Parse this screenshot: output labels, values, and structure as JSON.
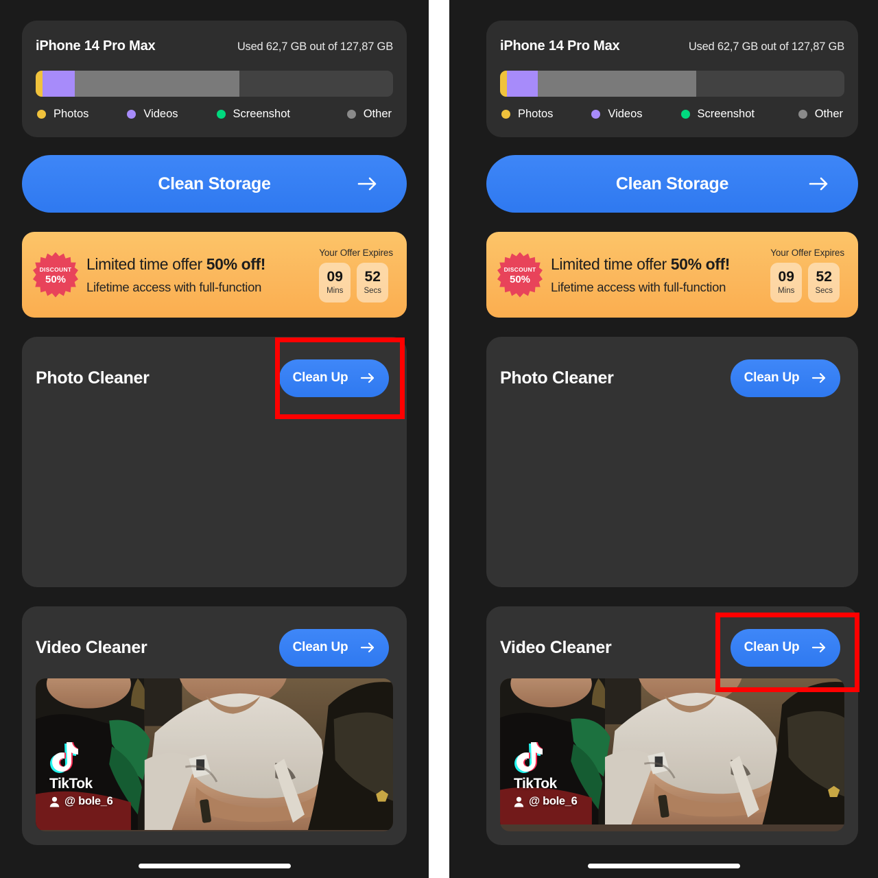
{
  "app": {
    "accent_blue": "#3b82f6",
    "card_bg": "#333333",
    "panel_bg": "#1b1b1b",
    "highlight_color": "#FF0000"
  },
  "storage": {
    "device_name": "iPhone 14 Pro Max",
    "used_text": "Used 62,7 GB out of 127,87 GB",
    "segments": [
      {
        "name": "Photos",
        "color": "#F0C23C",
        "percent": 2
      },
      {
        "name": "Videos",
        "color": "#A78BFA",
        "percent": 9
      },
      {
        "name": "Other",
        "color": "#7a7a7a",
        "percent": 46
      }
    ],
    "legend": [
      {
        "label": "Photos",
        "color": "#F0C23C"
      },
      {
        "label": "Videos",
        "color": "#A78BFA"
      },
      {
        "label": "Screenshot",
        "color": "#00D97E"
      },
      {
        "label": "Other",
        "color": "#8A8A8A"
      }
    ]
  },
  "clean_storage": {
    "label": "Clean Storage",
    "icon": "arrow-right-icon"
  },
  "offer": {
    "badge_line1": "DISCOUNT",
    "badge_line2": "50%",
    "headline_prefix": "Limited time offer ",
    "headline_strong": "50% off!",
    "subline": "Lifetime access with full-function",
    "expires_caption": "Your Offer Expires",
    "timer": [
      {
        "value": "09",
        "unit": "Mins"
      },
      {
        "value": "52",
        "unit": "Secs"
      }
    ]
  },
  "cards": [
    {
      "title": "Photo Cleaner",
      "button_label": "Clean Up",
      "button_icon": "arrow-right-icon"
    },
    {
      "title": "Video Cleaner",
      "button_label": "Clean Up",
      "button_icon": "arrow-right-icon"
    }
  ],
  "video_thumb": {
    "watermark_word": "TikTok",
    "handle": "@ bole_6",
    "logo_icon": "tiktok-note-icon",
    "user_icon": "person-icon"
  }
}
